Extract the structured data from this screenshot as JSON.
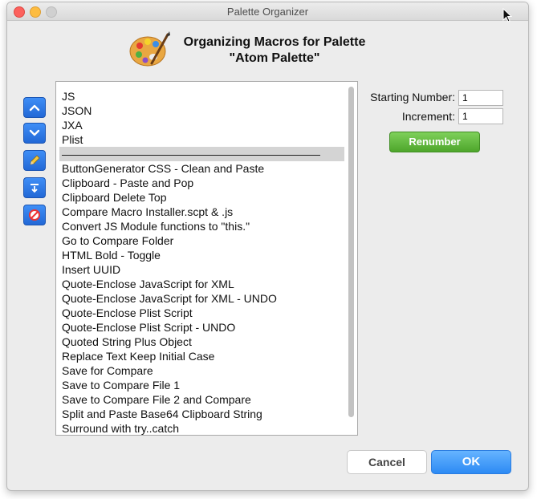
{
  "window": {
    "title": "Palette Organizer"
  },
  "header": {
    "title_line1": "Organizing Macros for Palette",
    "title_line2": "\"Atom Palette\""
  },
  "sidebar": {
    "buttons": [
      "chevron-up-icon",
      "chevron-down-icon",
      "pencil-icon",
      "insert-separator-icon",
      "remove-icon"
    ]
  },
  "list": {
    "items": [
      "JS",
      "JSON",
      "JXA",
      "Plist",
      "———————————————————————",
      "ButtonGenerator CSS - Clean and Paste",
      "Clipboard - Paste and Pop",
      "Clipboard Delete Top",
      "Compare Macro Installer.scpt & .js",
      "Convert JS Module functions to \"this.\"",
      "Go to Compare Folder",
      "HTML Bold - Toggle",
      "Insert UUID",
      "Quote-Enclose JavaScript for XML",
      "Quote-Enclose JavaScript for XML - UNDO",
      "Quote-Enclose Plist Script",
      "Quote-Enclose Plist Script - UNDO",
      "Quoted String Plus Object",
      "Replace Text Keep Initial Case",
      "Save for Compare",
      "Save to Compare File 1",
      "Save to Compare File 2 and Compare",
      "Split and Paste Base64 Clipboard String",
      "Surround with try..catch"
    ],
    "selected_index": 4
  },
  "renumber": {
    "starting_label": "Starting Number:",
    "starting_value": "1",
    "increment_label": "Increment:",
    "increment_value": "1",
    "button_label": "Renumber"
  },
  "footer": {
    "cancel_label": "Cancel",
    "ok_label": "OK"
  },
  "colors": {
    "accent": "#2c8af4",
    "renumber_green": "#5cb336",
    "side_button_blue": "#2f7ae8"
  }
}
